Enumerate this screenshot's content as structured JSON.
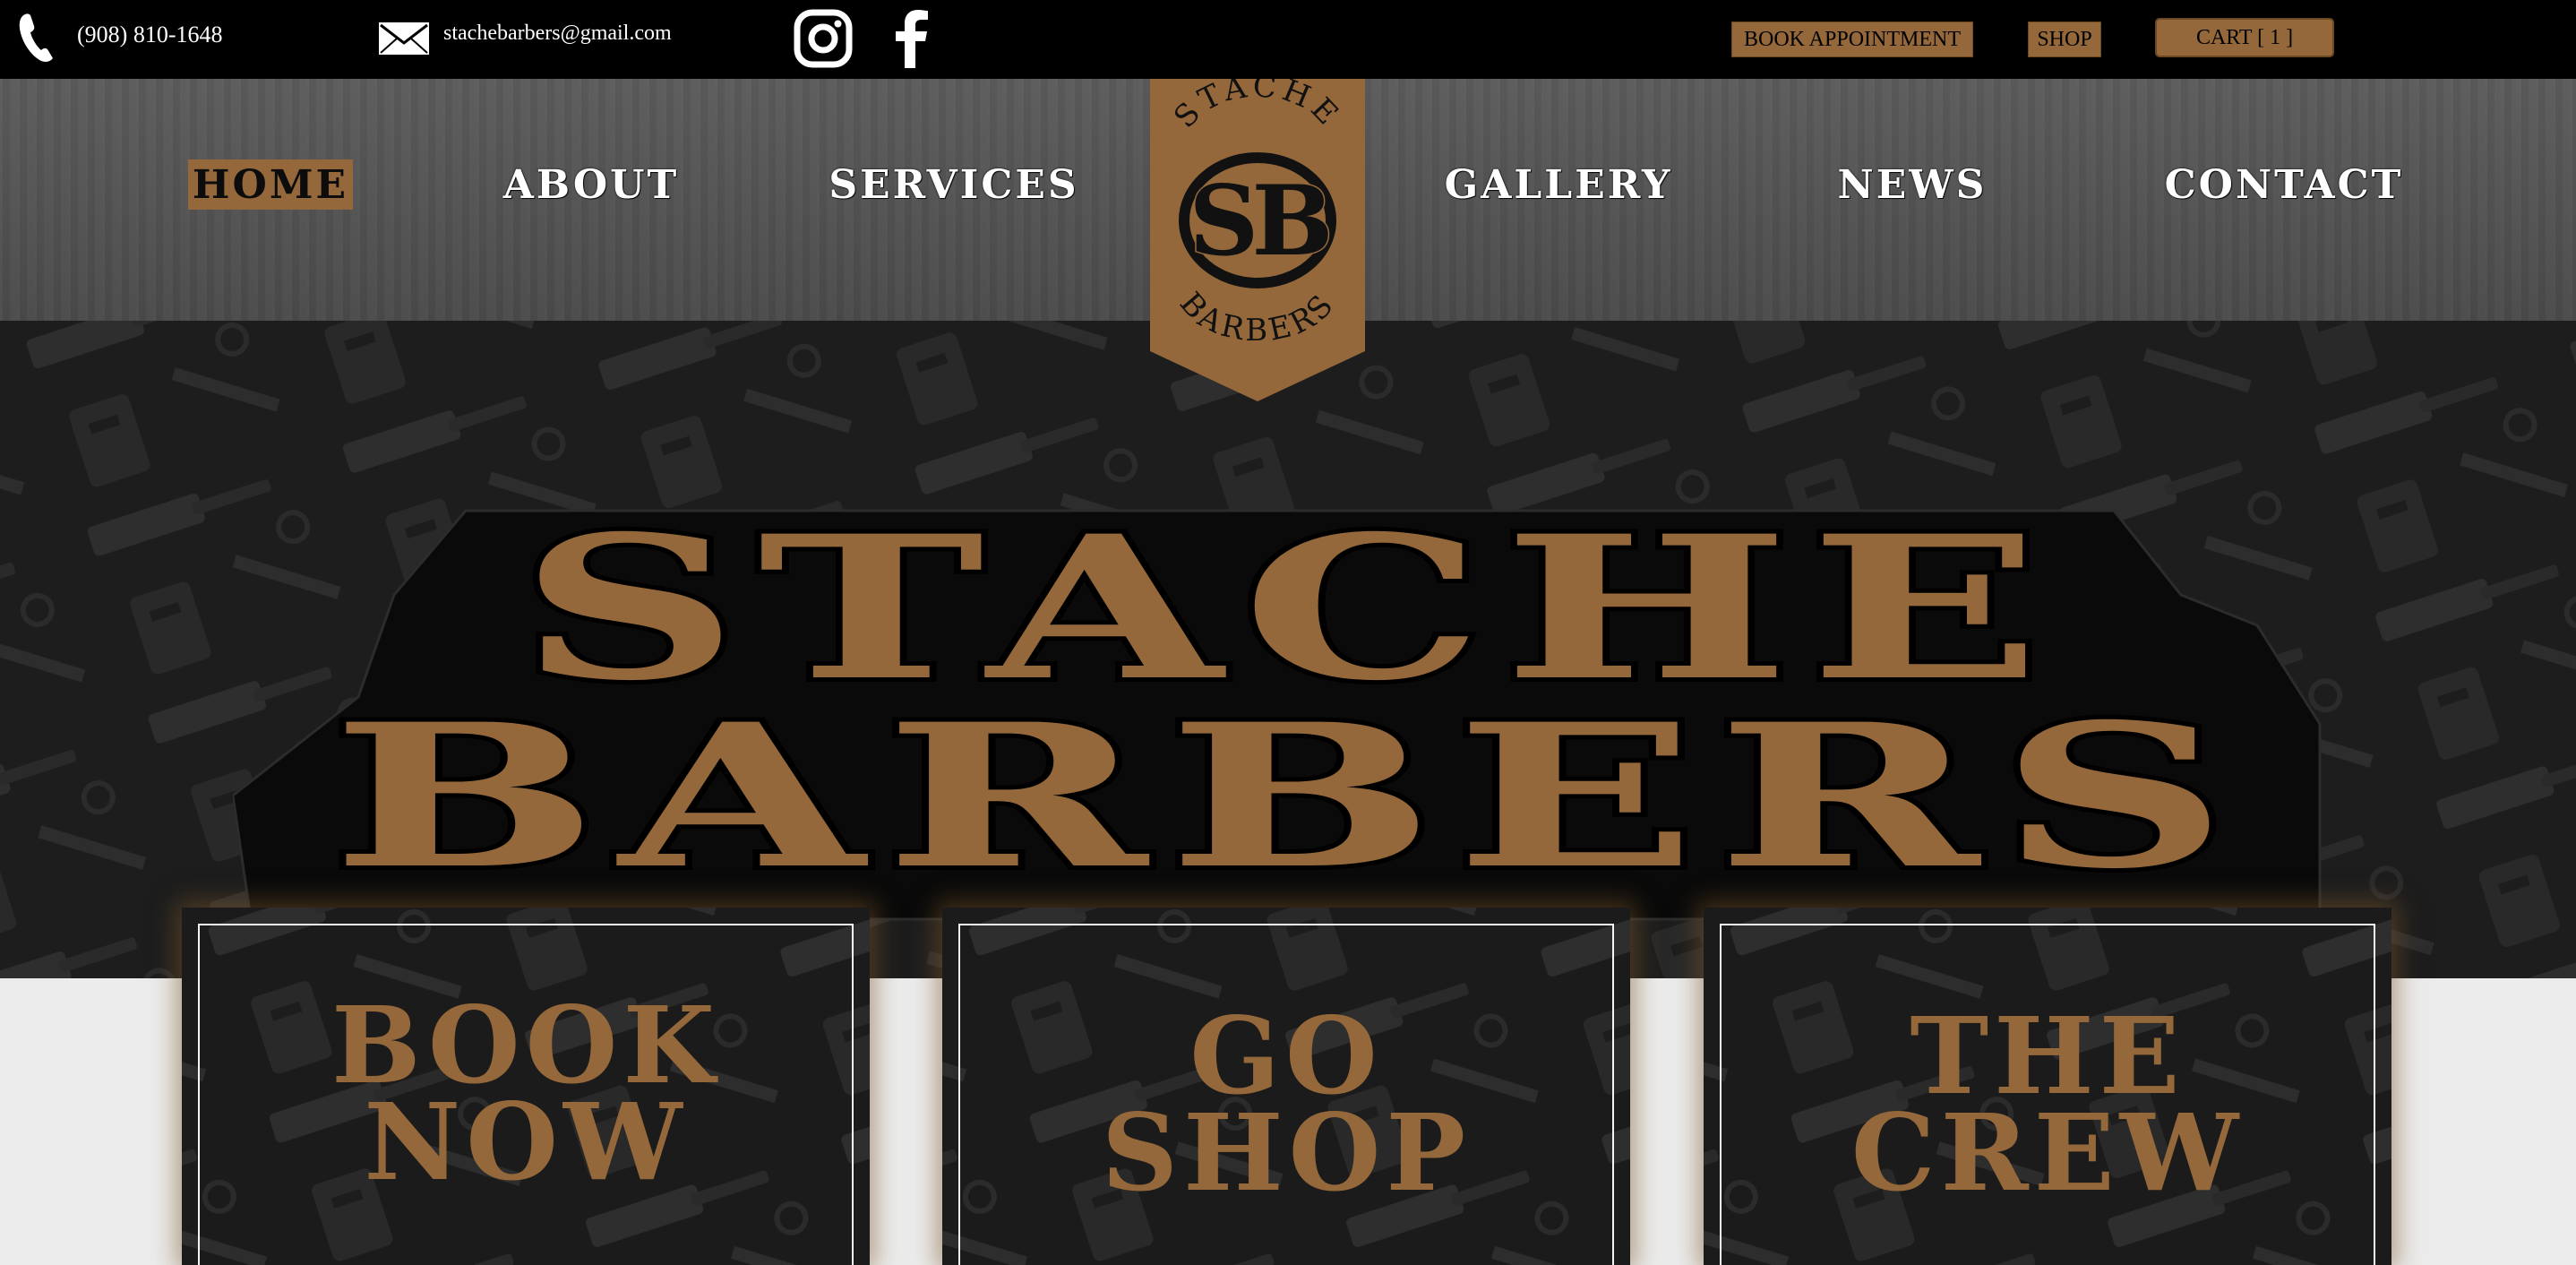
{
  "topbar": {
    "phone": "(908) 810-1648",
    "email": "stachebarbers@gmail.com",
    "social": [
      "instagram-icon",
      "facebook-icon"
    ],
    "book_label": "BOOK APPOINTMENT",
    "shop_label": "SHOP",
    "cart_label": "CART [ 1 ]"
  },
  "nav": {
    "items": [
      {
        "label": "HOME",
        "active": true
      },
      {
        "label": "ABOUT"
      },
      {
        "label": "SERVICES"
      },
      {
        "label": "GALLERY"
      },
      {
        "label": "NEWS"
      },
      {
        "label": "CONTACT"
      }
    ]
  },
  "logo": {
    "top": "STACHE",
    "monogram": "SB",
    "bottom": "BARBERS"
  },
  "hero": {
    "line1": "STACHE",
    "line2": "BARBERS"
  },
  "cards": [
    {
      "line1": "BOOK",
      "line2": "NOW"
    },
    {
      "line1": "GO",
      "line2": "SHOP"
    },
    {
      "line1": "THE",
      "line2": "CREW"
    }
  ],
  "colors": {
    "accent": "#94683a",
    "topbar_bg": "#000000",
    "nav_bg": "#555555",
    "hero_bg": "#1d1d1d",
    "page_bg": "#ececec"
  }
}
